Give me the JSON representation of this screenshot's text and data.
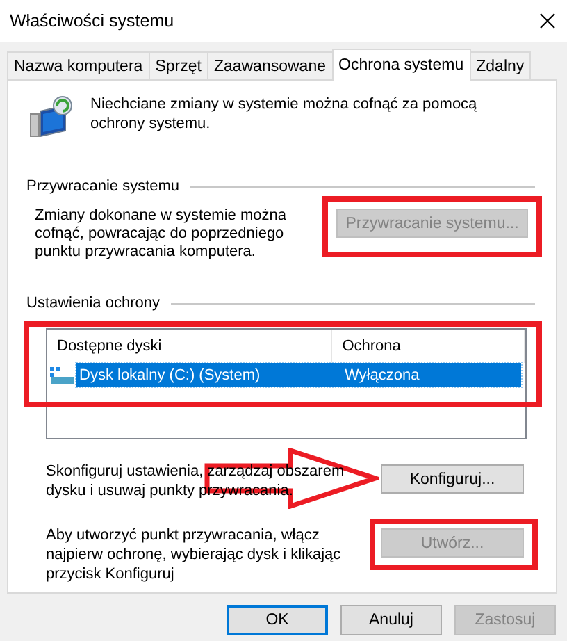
{
  "window": {
    "title": "Właściwości systemu"
  },
  "tabs": [
    {
      "label": "Nazwa komputera",
      "selected": false
    },
    {
      "label": "Sprzęt",
      "selected": false
    },
    {
      "label": "Zaawansowane",
      "selected": false
    },
    {
      "label": "Ochrona systemu",
      "selected": true
    },
    {
      "label": "Zdalny",
      "selected": false
    }
  ],
  "intro": "Niechciane zmiany w systemie można cofnąć za pomocą ochrony systemu.",
  "restore": {
    "heading": "Przywracanie systemu",
    "text": "Zmiany dokonane w systemie można cofnąć, powracając do poprzedniego punktu przywracania komputera.",
    "button": {
      "label": "Przywracanie systemu...",
      "disabled": true,
      "highlighted": true
    }
  },
  "protection": {
    "heading": "Ustawienia ochrony",
    "list": {
      "highlighted": true,
      "columns": [
        "Dostępne dyski",
        "Ochrona"
      ],
      "rows": [
        {
          "drive": "Dysk lokalny (C:) (System)",
          "protection": "Wyłączona",
          "selected": true
        }
      ]
    },
    "configure": {
      "text": "Skonfiguruj ustawienia, zarządzaj obszarem dysku i usuwaj punkty przywracania.",
      "arrow": true,
      "button": {
        "label": "Konfiguruj...",
        "disabled": false
      }
    },
    "create": {
      "text": "Aby utworzyć punkt przywracania, włącz najpierw ochronę, wybierając dysk i klikając przycisk Konfiguruj",
      "button": {
        "label": "Utwórz...",
        "disabled": true,
        "highlighted": true
      }
    }
  },
  "buttons": [
    {
      "label": "OK",
      "default": true,
      "disabled": false
    },
    {
      "label": "Anuluj",
      "default": false,
      "disabled": false
    },
    {
      "label": "Zastosuj",
      "default": false,
      "disabled": true
    }
  ]
}
